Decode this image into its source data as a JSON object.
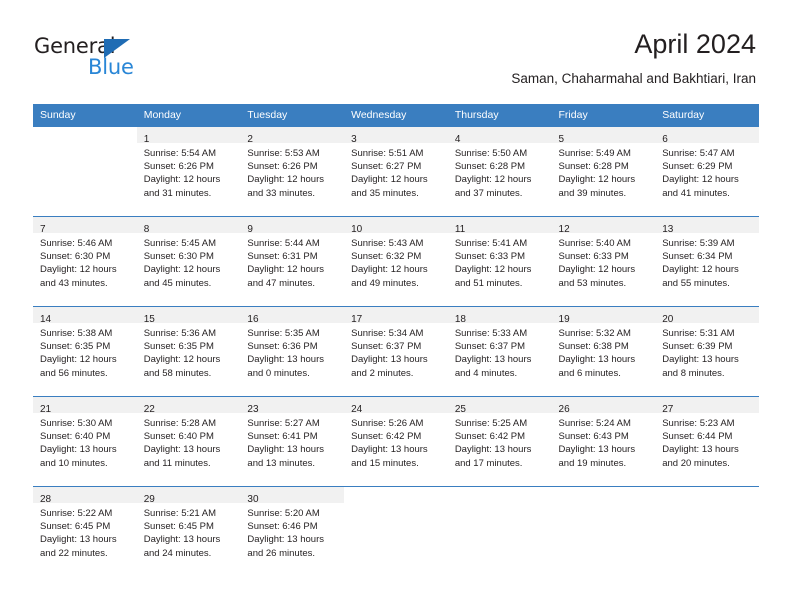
{
  "brand": {
    "name_part1": "General",
    "name_part2": "Blue",
    "triangle_color": "#1f6cb4",
    "blue_text_color": "#2986d6"
  },
  "header": {
    "title": "April 2024",
    "subtitle": "Saman, Chaharmahal and Bakhtiari, Iran"
  },
  "theme": {
    "header_row_color": "#3a7ec0",
    "daynum_bg": "#f1f1f1",
    "text_color": "#231f20"
  },
  "calendar": {
    "weekday_headers": [
      "Sunday",
      "Monday",
      "Tuesday",
      "Wednesday",
      "Thursday",
      "Friday",
      "Saturday"
    ],
    "weeks": [
      [
        {
          "day": "",
          "lines": []
        },
        {
          "day": "1",
          "lines": [
            "Sunrise: 5:54 AM",
            "Sunset: 6:26 PM",
            "Daylight: 12 hours",
            "and 31 minutes."
          ]
        },
        {
          "day": "2",
          "lines": [
            "Sunrise: 5:53 AM",
            "Sunset: 6:26 PM",
            "Daylight: 12 hours",
            "and 33 minutes."
          ]
        },
        {
          "day": "3",
          "lines": [
            "Sunrise: 5:51 AM",
            "Sunset: 6:27 PM",
            "Daylight: 12 hours",
            "and 35 minutes."
          ]
        },
        {
          "day": "4",
          "lines": [
            "Sunrise: 5:50 AM",
            "Sunset: 6:28 PM",
            "Daylight: 12 hours",
            "and 37 minutes."
          ]
        },
        {
          "day": "5",
          "lines": [
            "Sunrise: 5:49 AM",
            "Sunset: 6:28 PM",
            "Daylight: 12 hours",
            "and 39 minutes."
          ]
        },
        {
          "day": "6",
          "lines": [
            "Sunrise: 5:47 AM",
            "Sunset: 6:29 PM",
            "Daylight: 12 hours",
            "and 41 minutes."
          ]
        }
      ],
      [
        {
          "day": "7",
          "lines": [
            "Sunrise: 5:46 AM",
            "Sunset: 6:30 PM",
            "Daylight: 12 hours",
            "and 43 minutes."
          ]
        },
        {
          "day": "8",
          "lines": [
            "Sunrise: 5:45 AM",
            "Sunset: 6:30 PM",
            "Daylight: 12 hours",
            "and 45 minutes."
          ]
        },
        {
          "day": "9",
          "lines": [
            "Sunrise: 5:44 AM",
            "Sunset: 6:31 PM",
            "Daylight: 12 hours",
            "and 47 minutes."
          ]
        },
        {
          "day": "10",
          "lines": [
            "Sunrise: 5:43 AM",
            "Sunset: 6:32 PM",
            "Daylight: 12 hours",
            "and 49 minutes."
          ]
        },
        {
          "day": "11",
          "lines": [
            "Sunrise: 5:41 AM",
            "Sunset: 6:33 PM",
            "Daylight: 12 hours",
            "and 51 minutes."
          ]
        },
        {
          "day": "12",
          "lines": [
            "Sunrise: 5:40 AM",
            "Sunset: 6:33 PM",
            "Daylight: 12 hours",
            "and 53 minutes."
          ]
        },
        {
          "day": "13",
          "lines": [
            "Sunrise: 5:39 AM",
            "Sunset: 6:34 PM",
            "Daylight: 12 hours",
            "and 55 minutes."
          ]
        }
      ],
      [
        {
          "day": "14",
          "lines": [
            "Sunrise: 5:38 AM",
            "Sunset: 6:35 PM",
            "Daylight: 12 hours",
            "and 56 minutes."
          ]
        },
        {
          "day": "15",
          "lines": [
            "Sunrise: 5:36 AM",
            "Sunset: 6:35 PM",
            "Daylight: 12 hours",
            "and 58 minutes."
          ]
        },
        {
          "day": "16",
          "lines": [
            "Sunrise: 5:35 AM",
            "Sunset: 6:36 PM",
            "Daylight: 13 hours",
            "and 0 minutes."
          ]
        },
        {
          "day": "17",
          "lines": [
            "Sunrise: 5:34 AM",
            "Sunset: 6:37 PM",
            "Daylight: 13 hours",
            "and 2 minutes."
          ]
        },
        {
          "day": "18",
          "lines": [
            "Sunrise: 5:33 AM",
            "Sunset: 6:37 PM",
            "Daylight: 13 hours",
            "and 4 minutes."
          ]
        },
        {
          "day": "19",
          "lines": [
            "Sunrise: 5:32 AM",
            "Sunset: 6:38 PM",
            "Daylight: 13 hours",
            "and 6 minutes."
          ]
        },
        {
          "day": "20",
          "lines": [
            "Sunrise: 5:31 AM",
            "Sunset: 6:39 PM",
            "Daylight: 13 hours",
            "and 8 minutes."
          ]
        }
      ],
      [
        {
          "day": "21",
          "lines": [
            "Sunrise: 5:30 AM",
            "Sunset: 6:40 PM",
            "Daylight: 13 hours",
            "and 10 minutes."
          ]
        },
        {
          "day": "22",
          "lines": [
            "Sunrise: 5:28 AM",
            "Sunset: 6:40 PM",
            "Daylight: 13 hours",
            "and 11 minutes."
          ]
        },
        {
          "day": "23",
          "lines": [
            "Sunrise: 5:27 AM",
            "Sunset: 6:41 PM",
            "Daylight: 13 hours",
            "and 13 minutes."
          ]
        },
        {
          "day": "24",
          "lines": [
            "Sunrise: 5:26 AM",
            "Sunset: 6:42 PM",
            "Daylight: 13 hours",
            "and 15 minutes."
          ]
        },
        {
          "day": "25",
          "lines": [
            "Sunrise: 5:25 AM",
            "Sunset: 6:42 PM",
            "Daylight: 13 hours",
            "and 17 minutes."
          ]
        },
        {
          "day": "26",
          "lines": [
            "Sunrise: 5:24 AM",
            "Sunset: 6:43 PM",
            "Daylight: 13 hours",
            "and 19 minutes."
          ]
        },
        {
          "day": "27",
          "lines": [
            "Sunrise: 5:23 AM",
            "Sunset: 6:44 PM",
            "Daylight: 13 hours",
            "and 20 minutes."
          ]
        }
      ],
      [
        {
          "day": "28",
          "lines": [
            "Sunrise: 5:22 AM",
            "Sunset: 6:45 PM",
            "Daylight: 13 hours",
            "and 22 minutes."
          ]
        },
        {
          "day": "29",
          "lines": [
            "Sunrise: 5:21 AM",
            "Sunset: 6:45 PM",
            "Daylight: 13 hours",
            "and 24 minutes."
          ]
        },
        {
          "day": "30",
          "lines": [
            "Sunrise: 5:20 AM",
            "Sunset: 6:46 PM",
            "Daylight: 13 hours",
            "and 26 minutes."
          ]
        },
        {
          "day": "",
          "lines": []
        },
        {
          "day": "",
          "lines": []
        },
        {
          "day": "",
          "lines": []
        },
        {
          "day": "",
          "lines": []
        }
      ]
    ]
  }
}
